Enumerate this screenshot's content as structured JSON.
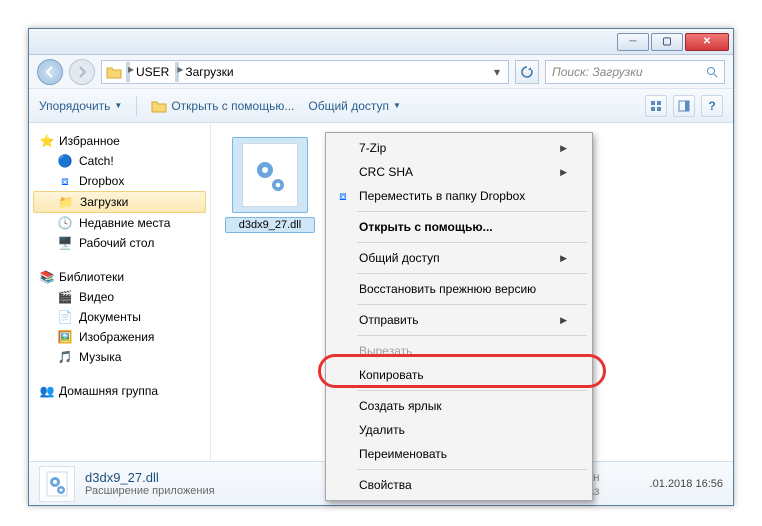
{
  "breadcrumb": {
    "seg1": "USER",
    "seg2": "Загрузки"
  },
  "search": {
    "placeholder": "Поиск: Загрузки"
  },
  "toolbar": {
    "organize": "Упорядочить",
    "open_with": "Открыть с помощью...",
    "share": "Общий доступ"
  },
  "sidebar": {
    "favorites": {
      "title": "Избранное",
      "items": [
        "Catch!",
        "Dropbox",
        "Загрузки",
        "Недавние места",
        "Рабочий стол"
      ]
    },
    "libraries": {
      "title": "Библиотеки",
      "items": [
        "Видео",
        "Документы",
        "Изображения",
        "Музыка"
      ]
    },
    "homegroup": {
      "title": "Домашняя группа"
    }
  },
  "file": {
    "name": "d3dx9_27.dll"
  },
  "context_menu": {
    "items": [
      {
        "label": "7-Zip",
        "sub": true
      },
      {
        "label": "CRC SHA",
        "sub": true
      },
      {
        "label": "Переместить в папку Dropbox",
        "icon": "dropbox"
      },
      {
        "sep": true
      },
      {
        "label": "Открыть с помощью...",
        "bold": true
      },
      {
        "sep": true
      },
      {
        "label": "Общий доступ",
        "sub": true
      },
      {
        "sep": true
      },
      {
        "label": "Восстановить прежнюю версию"
      },
      {
        "sep": true
      },
      {
        "label": "Отправить",
        "sub": true
      },
      {
        "sep": true
      },
      {
        "label": "Вырезать",
        "disabled": true
      },
      {
        "label": "Копировать"
      },
      {
        "sep": true
      },
      {
        "label": "Создать ярлык"
      },
      {
        "label": "Удалить"
      },
      {
        "label": "Переименовать"
      },
      {
        "sep": true
      },
      {
        "label": "Свойства"
      }
    ]
  },
  "status": {
    "filename": "d3dx9_27.dll",
    "filetype": "Расширение приложения",
    "date_label": "Дата измен",
    "size_label": "Раз",
    "date_value": ".01.2018 16:56"
  }
}
